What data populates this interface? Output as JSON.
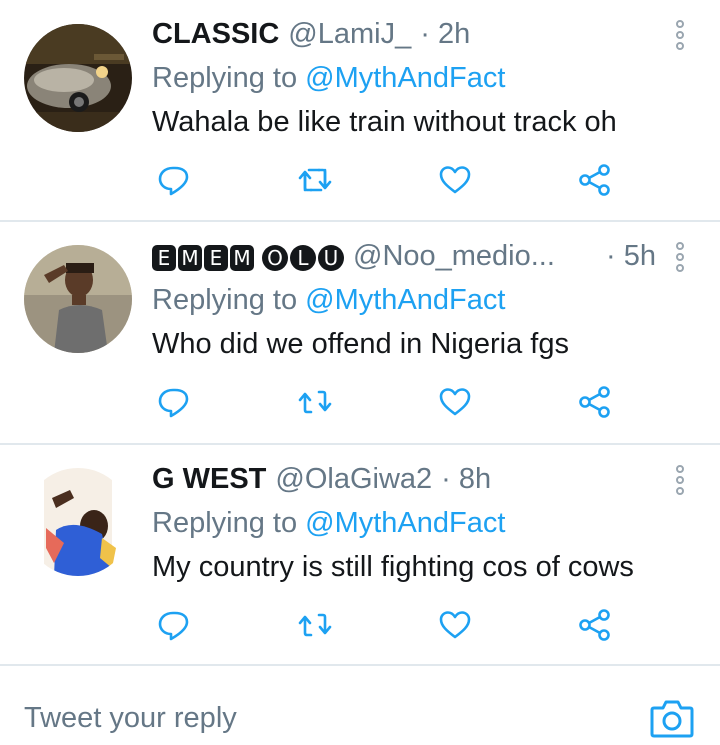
{
  "replies": [
    {
      "name": "CLASSIC",
      "handle": "@LamiJ_",
      "time": "· 2h",
      "replying_prefix": "Replying to ",
      "replying_to": "@MythAndFact",
      "text": "Wahala be like train without track oh"
    },
    {
      "name_badges": [
        "E",
        "M",
        "E",
        "M",
        "O",
        "L",
        "U"
      ],
      "handle": "@Noo_medio...",
      "time": "· 5h",
      "replying_prefix": "Replying to ",
      "replying_to": "@MythAndFact",
      "text": "Who did we offend in Nigeria fgs"
    },
    {
      "name": "G WEST",
      "handle": "@OlaGiwa2",
      "time": "· 8h",
      "replying_prefix": "Replying to ",
      "replying_to": "@MythAndFact",
      "text": "My country is still fighting cos of cows"
    }
  ],
  "actions": [
    "reply-icon",
    "retweet-icon",
    "like-icon",
    "share-icon"
  ],
  "compose": {
    "placeholder": "Tweet your reply"
  },
  "colors": {
    "accent": "#1da1f2",
    "secondary_text": "#657786",
    "icon": "#1da1f2",
    "divider": "#e1e8ed"
  }
}
